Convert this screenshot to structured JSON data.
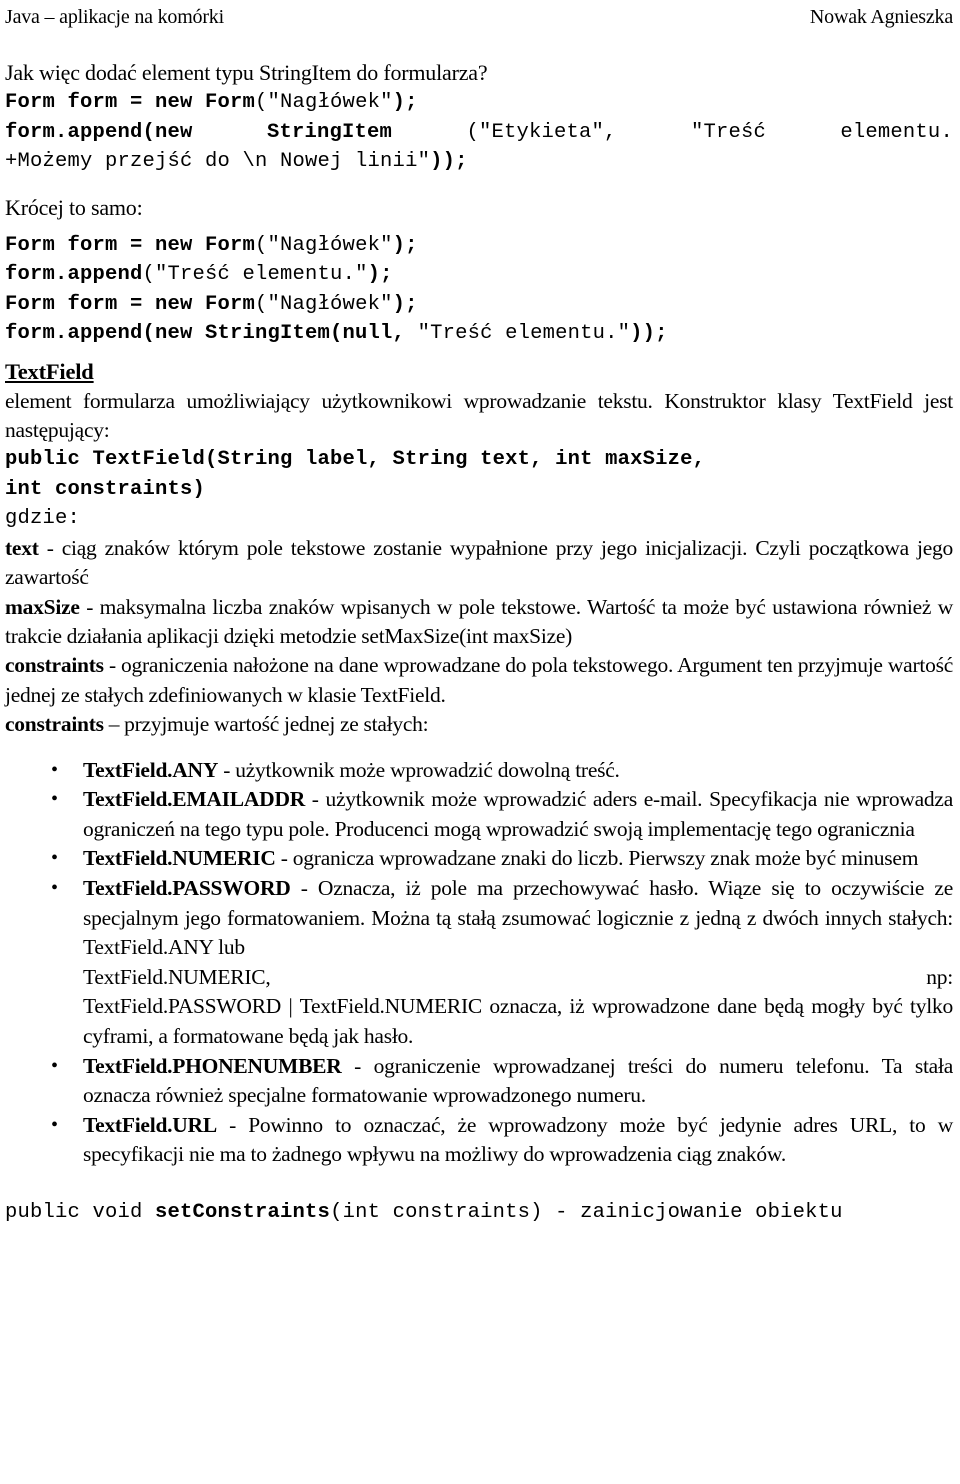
{
  "header": {
    "left": "Java – aplikacje na komórki",
    "right": "Nowak Agnieszka"
  },
  "intro": {
    "question": "Jak więc dodać element typu StringItem do formularza?"
  },
  "code_block_1": {
    "line1_bold_a": "Form form = new Form",
    "line1_plain_a": "(\"Nagłówek\"",
    "line1_bold_b": ");",
    "line2_bold_a": "form.append(new",
    "line2_bold_b": "StringItem",
    "line2_plain_a": "(\"Etykieta\",",
    "line2_plain_b": "\"Treść",
    "line2_plain_c": "elementu.",
    "line3_plain": "+Możemy przejść do \\n Nowej linii\"",
    "line3_bold": "));"
  },
  "shorter": {
    "label": "Krócej to samo:"
  },
  "code_block_2": {
    "l1_bold_a": "Form form = new Form",
    "l1_plain": "(\"Nagłówek\"",
    "l1_bold_b": ");",
    "l2_bold_a": "form.append",
    "l2_plain": "(\"Treść elementu.\"",
    "l2_bold_b": ");",
    "l3_bold_a": "Form form = new Form",
    "l3_plain": "(\"Nagłówek\"",
    "l3_bold_b": ");",
    "l4_bold_a": "form.append(new StringItem(null,",
    "l4_plain": " \"Treść elementu.\"",
    "l4_bold_b": "));"
  },
  "textfield_section": {
    "title": "TextField",
    "description": "element formularza umożliwiający użytkownikowi wprowadzanie tekstu. Konstruktor klasy TextField jest następujący:",
    "signature_line1": "public TextField(String label, String text, int maxSize,",
    "signature_line2": "int constraints)",
    "gdzie": "gdzie:"
  },
  "params": [
    {
      "name": "text",
      "description": " - ciąg znaków którym pole tekstowe zostanie wypałnione przy jego inicjalizacji. Czyli początkowa jego zawartość"
    },
    {
      "name": "maxSize",
      "description": " - maksymalna liczba znaków wpisanych w pole tekstowe. Wartość ta może być ustawiona również w trakcie działania aplikacji dzięki metodzie setMaxSize(int maxSize)"
    },
    {
      "name": "constraints",
      "description": " - ograniczenia nałożone na dane wprowadzane do pola tekstowego. Argument ten przyjmuje wartość jednej ze stałych zdefiniowanych w klasie TextField."
    },
    {
      "name": "constraints",
      "description": " – przyjmuje wartość jednej ze stałych:"
    }
  ],
  "constants": [
    {
      "name": "TextField.ANY",
      "description": " - użytkownik może wprowadzić dowolną treść."
    },
    {
      "name": "TextField.EMAILADDR",
      "description": " - użytkownik może wprowadzić aders e-mail. Specyfikacja nie wprowadza ograniczeń na tego typu pole. Producenci mogą wprowadzić swoją implementację tego ogranicznia"
    },
    {
      "name": "TextField.NUMERIC",
      "description": " - ogranicza wprowadzane znaki do liczb. Pierwszy znak może być minusem"
    },
    {
      "name": "TextField.PASSWORD",
      "description": " - Oznacza, iż pole ma przechowywać hasło. Wiąze się to oczywiście ze specjalnym jego formatowaniem. Można tą stałą zsumować logicznie z jedną z dwóch innych stałych: TextField.ANY lub",
      "split_left": "TextField.NUMERIC,",
      "split_right": "np:",
      "tail": "TextField.PASSWORD | TextField.NUMERIC oznacza, iż wprowadzone dane będą mogły być tylko cyframi, a formatowane będą jak hasło."
    },
    {
      "name": "TextField.PHONENUMBER",
      "description": " - ograniczenie wprowadzanej treści do numeru telefonu. Ta stała oznacza również specjalne formatowanie wprowadzonego numeru."
    },
    {
      "name": "TextField.URL",
      "description": " - Powinno to oznaczać, że wprowadzony może być jedynie adres URL, to w specyfikacji nie ma to żadnego wpływu na możliwy do wprowadzenia ciąg znaków."
    }
  ],
  "code_block_3": {
    "plain_a": "public void ",
    "bold_a": "setConstraints",
    "plain_b": "(int constraints) - zainicjowanie obiektu"
  }
}
